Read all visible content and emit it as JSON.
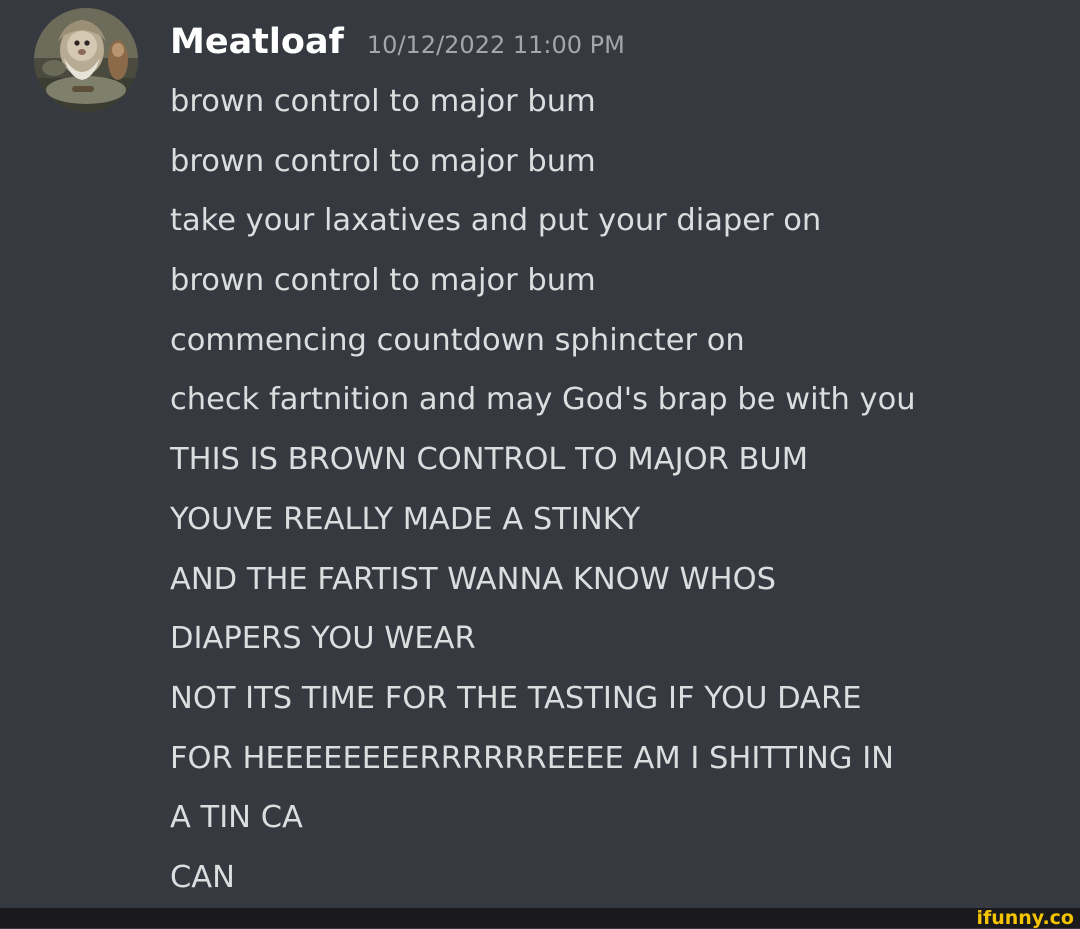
{
  "message": {
    "username": "Meatloaf",
    "timestamp": "10/12/2022 11:00 PM",
    "avatar_icon": "user-avatar",
    "lines": [
      "brown control to major bum",
      "brown control to major bum",
      "take your laxatives and put your diaper on",
      "brown control to major bum",
      "commencing countdown sphincter on",
      "check fartnition and may God's brap be with you",
      "THIS IS BROWN CONTROL TO MAJOR BUM",
      "YOUVE REALLY MADE A STINKY",
      "AND THE FARTIST WANNA KNOW WHOS",
      "DIAPERS YOU WEAR",
      "NOT ITS TIME FOR THE TASTING IF YOU DARE",
      "FOR HEEEEEEEERRRRRREEEE AM I SHITTING IN",
      "A TIN CA",
      "CAN"
    ]
  },
  "watermark": {
    "text": "ifunny.co"
  },
  "colors": {
    "background": "#36393f",
    "username": "#ffffff",
    "timestamp": "#a3a6aa",
    "message_text": "#dcddde",
    "footer": "#1a1a1c",
    "watermark": "#f5c400"
  }
}
